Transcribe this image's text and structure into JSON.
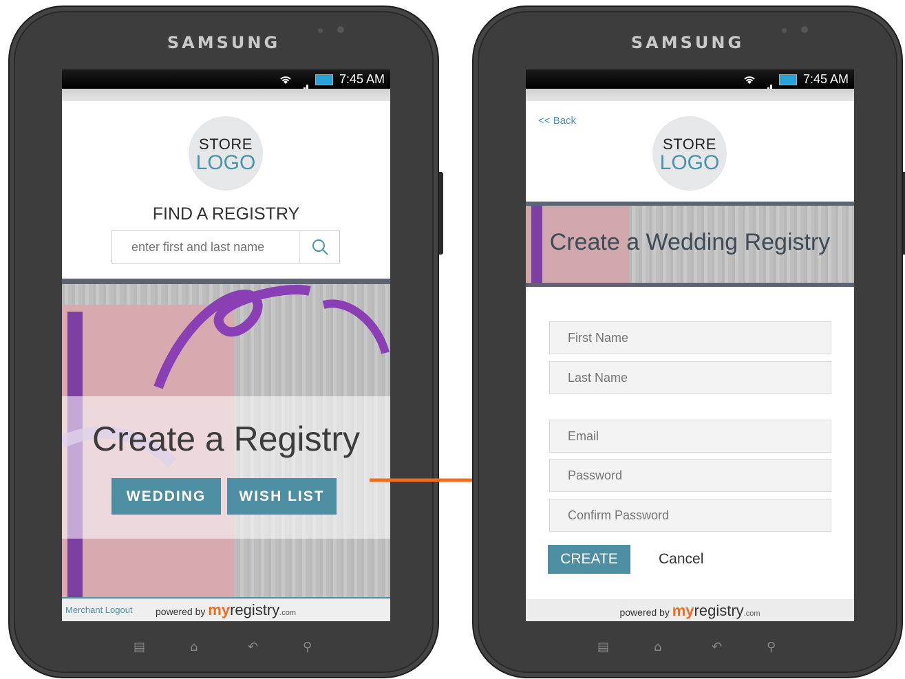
{
  "device_brand": "SAMSUNG",
  "status_bar": {
    "time": "7:45 AM"
  },
  "store_logo": {
    "line1": "STORE",
    "line2": "LOGO"
  },
  "left_screen": {
    "find_title": "FIND A REGISTRY",
    "search_placeholder": "enter first and last name",
    "hero_title": "Create a Registry",
    "btn_wedding": "WEDDING",
    "btn_wishlist": "WISH LIST",
    "merchant_logout": "Merchant Logout"
  },
  "right_screen": {
    "back_link": "<< Back",
    "banner_title": "Create a Wedding Registry",
    "fields": {
      "first_name": "First Name",
      "last_name": "Last Name",
      "email": "Email",
      "password": "Password",
      "confirm_password": "Confirm Password"
    },
    "create_label": "CREATE",
    "cancel_label": "Cancel"
  },
  "footer": {
    "powered_by": "powered by",
    "brand_my": "my",
    "brand_registry": "registry",
    "brand_com": ".com"
  },
  "colors": {
    "accent": "#4e8ea3",
    "orange": "#f26b21",
    "divider": "#5a6571",
    "ribbon": "#7e3fa3"
  },
  "icons": {
    "search": "search-icon",
    "wifi": "wifi-icon",
    "signal": "signal-icon",
    "battery": "battery-icon",
    "menu": "menu-key-icon",
    "home": "home-key-icon",
    "back": "back-key-icon",
    "search_key": "search-key-icon",
    "arrow": "arrow-right-icon"
  }
}
